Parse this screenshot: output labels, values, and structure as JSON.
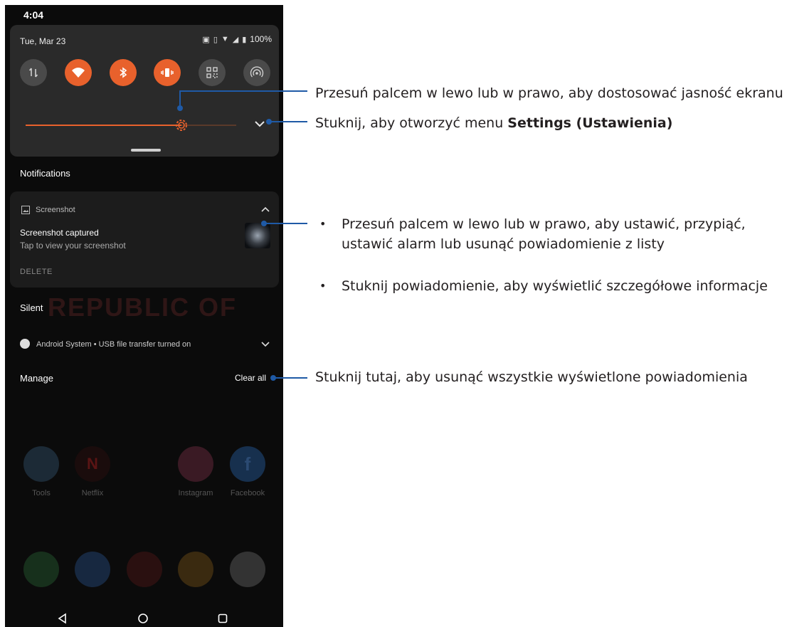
{
  "status_bar": {
    "time": "4:04"
  },
  "quick_settings": {
    "date": "Tue, Mar 23",
    "battery": "100%",
    "tiles": [
      {
        "name": "mobile-data",
        "on": false
      },
      {
        "name": "wifi",
        "on": true
      },
      {
        "name": "bluetooth",
        "on": true
      },
      {
        "name": "vibrate",
        "on": true
      },
      {
        "name": "qr-scanner",
        "on": false
      },
      {
        "name": "hotspot",
        "on": false
      }
    ],
    "brightness_fraction": 0.74,
    "accent_color": "#e8612c"
  },
  "notifications": {
    "title": "Notifications",
    "card": {
      "app": "Screenshot",
      "title": "Screenshot captured",
      "text": "Tap to view your screenshot",
      "action": "DELETE"
    },
    "silent_title": "Silent",
    "silent_item": "Android System • USB file transfer turned on",
    "manage": "Manage",
    "clear_all": "Clear all"
  },
  "wallpaper_text": "REPUBLIC OF",
  "apps": [
    {
      "label": "Tools",
      "icon": "folder-icon",
      "color": "#1c2a36"
    },
    {
      "label": "Netflix",
      "icon": "netflix-icon",
      "color": "#1a0c0c"
    },
    {
      "label": "Instagram",
      "icon": "instagram-icon",
      "color": "#3a1a24"
    },
    {
      "label": "Facebook",
      "icon": "facebook-icon",
      "color": "#17304e"
    }
  ],
  "dock": [
    {
      "icon": "phone-icon",
      "color": "#17301c"
    },
    {
      "icon": "messages-icon",
      "color": "#172840"
    },
    {
      "icon": "armoury-icon",
      "color": "#2a1010"
    },
    {
      "icon": "chrome-icon",
      "color": "#3a2a10"
    },
    {
      "icon": "camera-icon",
      "color": "#333333"
    }
  ],
  "callouts": {
    "brightness": "Przesuń palcem w lewo lub w prawo, aby dostosować jasność ekranu",
    "settings_prefix": "Stuknij, aby otworzyć menu ",
    "settings_bold": "Settings (Ustawienia)",
    "notif_swipe_line1": "Przesuń palcem w lewo lub w prawo, aby ustawić, przypiąć,",
    "notif_swipe_line2": "ustawić alarm lub usunąć powiadomienie z listy",
    "notif_tap": "Stuknij powiadomienie, aby wyświetlić szczegółowe informacje",
    "clear": "Stuknij tutaj, aby usunąć wszystkie wyświetlone powiadomienia",
    "bullet": "•",
    "line_color": "#1f5aa6"
  }
}
